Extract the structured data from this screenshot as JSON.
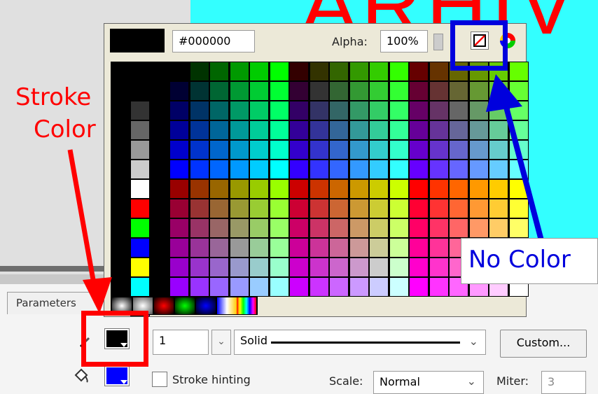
{
  "canvas": {
    "big_text": "ARHIV"
  },
  "popup": {
    "hex_value": "#000000",
    "alpha_label": "Alpha:",
    "alpha_value": "100%",
    "icons": {
      "no_color": "no-color-icon",
      "color_wheel": "color-wheel-icon"
    }
  },
  "panel": {
    "tab_label": "Parameters",
    "stroke_width": "1",
    "stroke_style": "Solid",
    "custom_button": "Custom...",
    "stroke_hinting_label": "Stroke hinting",
    "scale_label": "Scale:",
    "scale_value": "Normal",
    "miter_label": "Miter:",
    "miter_value": "3",
    "stroke_swatch_color": "#000000",
    "fill_swatch_color": "#0000ff"
  },
  "annotations": {
    "stroke_color_line1": "Stroke",
    "stroke_color_line2": "Color",
    "no_color": "No Color"
  },
  "colors": {
    "red_annotation": "#ff0000",
    "blue_annotation": "#0000dd",
    "stage_bg": "#33ffff"
  }
}
